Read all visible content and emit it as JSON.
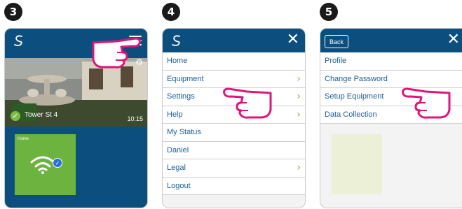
{
  "steps": [
    "3",
    "4",
    "5"
  ],
  "screen3": {
    "location": "Tower St 4",
    "time": "10:15",
    "tile_label": "Home"
  },
  "screen4": {
    "close_icon": "✕",
    "items": [
      {
        "label": "Home",
        "chevron": false
      },
      {
        "label": "Equipment",
        "chevron": true
      },
      {
        "label": "Settings",
        "chevron": true
      },
      {
        "label": "Help",
        "chevron": true
      },
      {
        "label": "My Status",
        "chevron": false
      },
      {
        "label": "Daniel",
        "chevron": false
      },
      {
        "label": "Legal",
        "chevron": true
      },
      {
        "label": "Logout",
        "chevron": false
      }
    ]
  },
  "screen5": {
    "back_label": "Back",
    "close_icon": "✕",
    "items": [
      "Profile",
      "Change Password",
      "Setup Equipment",
      "Data Collection"
    ]
  },
  "colors": {
    "header": "#0c4f7f",
    "link": "#1d5e97",
    "accent": "#7cbb3c",
    "tile": "#6db33f",
    "hand": "#e0147a"
  }
}
